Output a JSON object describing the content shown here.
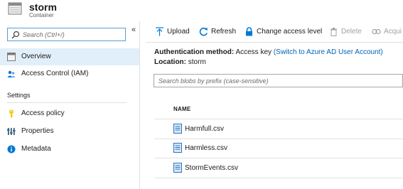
{
  "header": {
    "title": "storm",
    "subtitle": "Container",
    "icon": "container-icon"
  },
  "sidebar": {
    "search_placeholder": "Search (Ctrl+/)",
    "collapse_glyph": "«",
    "items": [
      {
        "label": "Overview",
        "icon": "overview-icon",
        "active": true
      },
      {
        "label": "Access Control (IAM)",
        "icon": "iam-icon",
        "active": false
      }
    ],
    "settings_title": "Settings",
    "settings_items": [
      {
        "label": "Access policy",
        "icon": "key-icon"
      },
      {
        "label": "Properties",
        "icon": "properties-icon"
      },
      {
        "label": "Metadata",
        "icon": "info-icon"
      }
    ]
  },
  "toolbar": {
    "buttons": [
      {
        "label": "Upload",
        "icon": "upload-icon",
        "enabled": true
      },
      {
        "label": "Refresh",
        "icon": "refresh-icon",
        "enabled": true
      },
      {
        "label": "Change access level",
        "icon": "lock-icon",
        "enabled": true
      },
      {
        "label": "Delete",
        "icon": "trash-icon",
        "enabled": false
      },
      {
        "label": "Acqui",
        "icon": "acquire-lease-icon",
        "enabled": false
      }
    ]
  },
  "auth": {
    "method_label": "Authentication method:",
    "method_value": "Access key",
    "switch_link": "(Switch to Azure AD User Account)",
    "location_label": "Location:",
    "location_value": "storm"
  },
  "blob_search": {
    "placeholder": "Search blobs by prefix (case-sensitive)"
  },
  "table": {
    "column_name": "NAME",
    "rows": [
      {
        "name": "Harmfull.csv",
        "icon": "file-icon"
      },
      {
        "name": "Harmless.csv",
        "icon": "file-icon"
      },
      {
        "name": "StormEvents.csv",
        "icon": "file-icon"
      }
    ]
  },
  "colors": {
    "accent": "#0078d4",
    "link": "#0063b1",
    "active_bg": "#e1effa",
    "disabled_text": "#a0a0a0"
  }
}
